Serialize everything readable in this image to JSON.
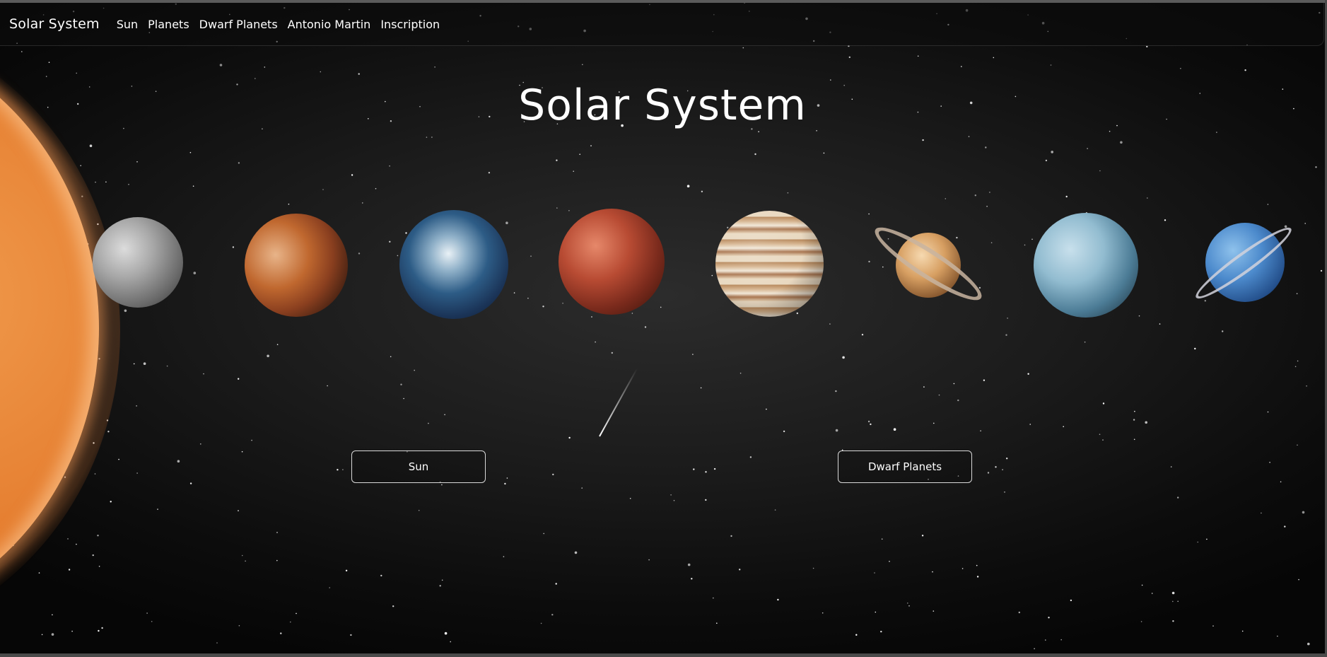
{
  "navbar": {
    "brand": "Solar System",
    "links": [
      "Sun",
      "Planets",
      "Dwarf Planets",
      "Antonio Martin",
      "Inscription"
    ]
  },
  "hero": {
    "title": "Solar System"
  },
  "planets": [
    "mercury",
    "venus",
    "earth",
    "mars",
    "jupiter",
    "saturn",
    "neptune",
    "uranus"
  ],
  "buttons": {
    "sun": "Sun",
    "dwarf_planets": "Dwarf Planets"
  },
  "colors": {
    "background": "#1b1b1b",
    "sun": "#e47b2d",
    "text": "#ffffff",
    "button_border": "#d9d9d9"
  }
}
